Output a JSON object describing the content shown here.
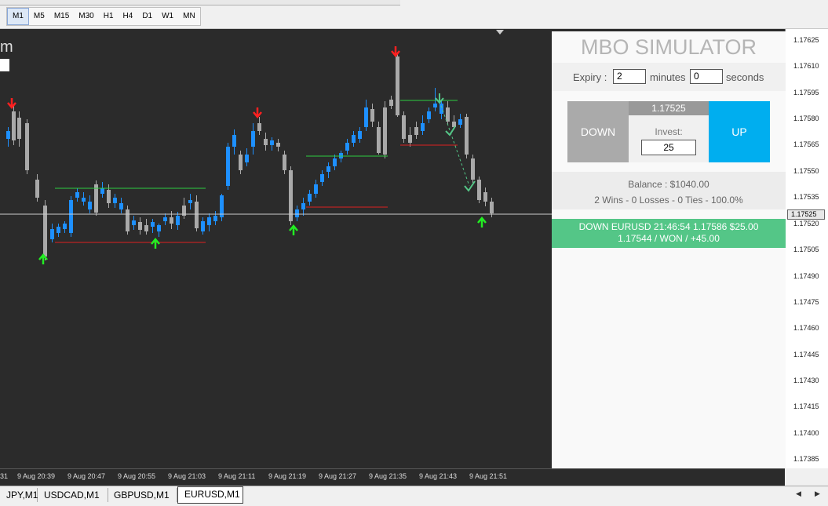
{
  "timeframes": [
    "M1",
    "M5",
    "M15",
    "M30",
    "H1",
    "H4",
    "D1",
    "W1",
    "MN"
  ],
  "active_timeframe": "M1",
  "chart": {
    "title_fragment": "m"
  },
  "price_axis": {
    "ticks": [
      "1.17625",
      "1.17610",
      "1.17595",
      "1.17580",
      "1.17565",
      "1.17550",
      "1.17535",
      "1.17520",
      "1.17505",
      "1.17490",
      "1.17475",
      "1.17460",
      "1.17445",
      "1.17430",
      "1.17415",
      "1.17400",
      "1.17385"
    ],
    "current": "1.17525"
  },
  "time_axis": {
    "ticks": [
      "31",
      "9 Aug 20:39",
      "9 Aug 20:47",
      "9 Aug 20:55",
      "9 Aug 21:03",
      "9 Aug 21:11",
      "9 Aug 21:19",
      "9 Aug 21:27",
      "9 Aug 21:35",
      "9 Aug 21:43",
      "9 Aug 21:51"
    ]
  },
  "tabs": [
    "JPY,M1",
    "USDCAD,M1",
    "GBPUSD,M1",
    "EURUSD,M1"
  ],
  "active_tab": "EURUSD,M1",
  "panel": {
    "title": "MBO SIMULATOR",
    "expiry_label": "Expiry :",
    "expiry_minutes": "2",
    "minutes_label": "minutes",
    "expiry_seconds": "0",
    "seconds_label": "seconds",
    "down_label": "DOWN",
    "up_label": "UP",
    "current_rate": "1.17525",
    "invest_label": "Invest:",
    "invest_value": "25",
    "balance": "Balance : $1040.00",
    "record": "2 Wins - 0 Losses - 0 Ties - 100.0%",
    "result_line1": "DOWN EURUSD 21:46:54 1.17586 $25.00",
    "result_line2": "1.17544 / WON / +45.00"
  },
  "colors": {
    "bull": "#1e90ff",
    "bear": "#a9a9a9",
    "up_button": "#00aeef",
    "down_button": "#aaaaaa",
    "win": "#54c687",
    "sell_arrow": "#ff2020",
    "buy_arrow": "#22ee22"
  }
}
